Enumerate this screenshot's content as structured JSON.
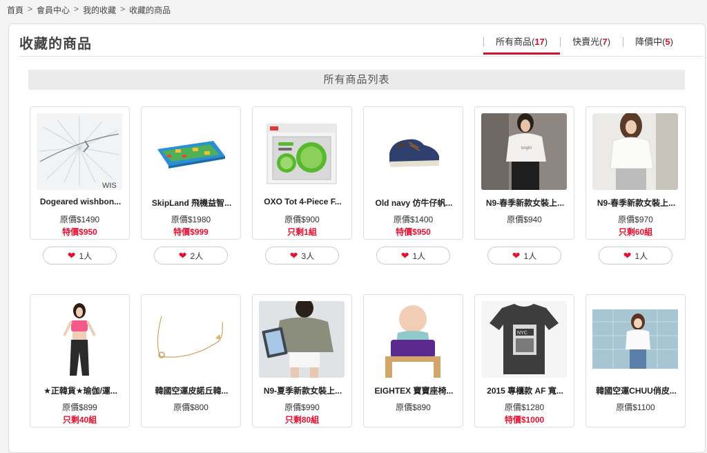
{
  "breadcrumb": {
    "items": [
      "首頁",
      "會員中心",
      "我的收藏",
      "收藏的商品"
    ],
    "separator": ">"
  },
  "page_title": "收藏的商品",
  "tabs": [
    {
      "label": "所有商品",
      "count": "17",
      "active": true
    },
    {
      "label": "快賣光",
      "count": "7",
      "active": false
    },
    {
      "label": "降價中",
      "count": "5",
      "active": false
    }
  ],
  "section_title": "所有商品列表",
  "colors": {
    "accent": "#d0122c",
    "sale": "#e3102f"
  },
  "products": [
    {
      "name": "Dogeared wishbon...",
      "orig": "原價$1490",
      "sale": "特價$950",
      "likes": "1人"
    },
    {
      "name": "SkipLand 飛機益智...",
      "orig": "原價$1980",
      "sale": "特價$999",
      "likes": "2人"
    },
    {
      "name": "OXO Tot 4-Piece F...",
      "orig": "原價$900",
      "sale": "只剩1組",
      "likes": "3人"
    },
    {
      "name": "Old navy 仿牛仔帆...",
      "orig": "原價$1400",
      "sale": "特價$950",
      "likes": "1人"
    },
    {
      "name": "N9-春季新款女裝上...",
      "orig": "原價$940",
      "sale": "",
      "likes": "1人"
    },
    {
      "name": "N9-春季新款女裝上...",
      "orig": "原價$970",
      "sale": "只剩60組",
      "likes": "1人"
    },
    {
      "name": "★正韓貨★瑜伽/運...",
      "orig": "原價$899",
      "sale": "只剩40組",
      "likes": ""
    },
    {
      "name": "韓國空運皮諾丘韓...",
      "orig": "原價$800",
      "sale": "",
      "likes": ""
    },
    {
      "name": "N9-夏季新款女裝上...",
      "orig": "原價$990",
      "sale": "只剩80組",
      "likes": ""
    },
    {
      "name": "EIGHTEX 寶寶座椅...",
      "orig": "原價$890",
      "sale": "",
      "likes": ""
    },
    {
      "name": "2015 專櫃款 AF 寬...",
      "orig": "原價$1280",
      "sale": "特價$1000",
      "likes": ""
    },
    {
      "name": "韓國空運CHUU俏皮...",
      "orig": "原價$1100",
      "sale": "",
      "likes": ""
    }
  ]
}
